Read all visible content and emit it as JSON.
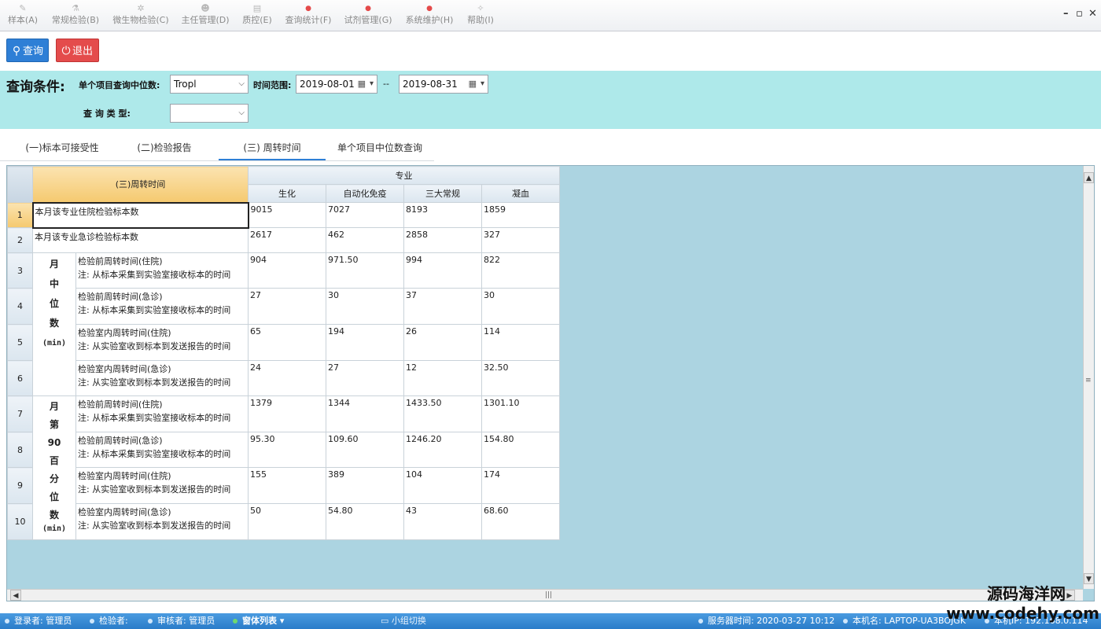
{
  "menu": [
    {
      "label": "样本(A)",
      "icon": "pen-icon"
    },
    {
      "label": "常规检验(B)",
      "icon": "flask-icon"
    },
    {
      "label": "微生物检验(C)",
      "icon": "microbe-icon"
    },
    {
      "label": "主任管理(D)",
      "icon": "people-icon"
    },
    {
      "label": "质控(E)",
      "icon": "doc-icon"
    },
    {
      "label": "查询统计(F)",
      "icon": "red-dot-icon"
    },
    {
      "label": "试剂管理(G)",
      "icon": "red-dot-icon"
    },
    {
      "label": "系统维护(H)",
      "icon": "red-dot-icon"
    },
    {
      "label": "帮助(I)",
      "icon": "help-icon"
    }
  ],
  "window_controls": {
    "minimize": "–",
    "restore": "▫",
    "close": "✕"
  },
  "toolbar": {
    "query_label": "查询",
    "exit_label": "退出",
    "query_icon": "search-icon",
    "exit_icon": "power-icon"
  },
  "conditions": {
    "title": "查询条件:",
    "median_label": "单个项目查询中位数:",
    "median_value": "Tropl",
    "time_label": "时间范围:",
    "date_from": "2019-08-01",
    "date_sep": "--",
    "date_to": "2019-08-31",
    "type_label": "查 询 类 型:",
    "type_value": ""
  },
  "tabs": [
    {
      "label": "(一)标本可接受性",
      "active": false
    },
    {
      "label": "(二)检验报告",
      "active": false
    },
    {
      "label": "(三) 周转时间",
      "active": true
    },
    {
      "label": "单个项目中位数查询",
      "active": false
    }
  ],
  "grid": {
    "main_header": "(三)周转时间",
    "group_header": "专业",
    "columns": [
      "生化",
      "自动化免疫",
      "三大常规",
      "凝血"
    ],
    "row_numbers": [
      "1",
      "2",
      "3",
      "4",
      "5",
      "6",
      "7",
      "8",
      "9",
      "10"
    ],
    "summary_rows": [
      {
        "label": "本月该专业住院检验标本数",
        "values": [
          "9015",
          "7027",
          "8193",
          "1859"
        ]
      },
      {
        "label": "本月该专业急诊检验标本数",
        "values": [
          "2617",
          "462",
          "2858",
          "327"
        ]
      }
    ],
    "groups": [
      {
        "chars": [
          "月",
          "中",
          "位",
          "数"
        ],
        "unit": "(min)",
        "rows": [
          {
            "line1": "检验前周转时间(住院)",
            "line2": "注: 从标本采集到实验室接收标本的时间",
            "values": [
              "904",
              "971.50",
              "994",
              "822"
            ]
          },
          {
            "line1": "检验前周转时间(急诊)",
            "line2": "注: 从标本采集到实验室接收标本的时间",
            "values": [
              "27",
              "30",
              "37",
              "30"
            ]
          },
          {
            "line1": "检验室内周转时间(住院)",
            "line2": " 注: 从实验室收到标本到发送报告的时间",
            "values": [
              "65",
              "194",
              "26",
              "114"
            ]
          },
          {
            "line1": "检验室内周转时间(急诊)",
            "line2": " 注: 从实验室收到标本到发送报告的时间",
            "values": [
              "24",
              "27",
              "12",
              "32.50"
            ]
          }
        ]
      },
      {
        "chars": [
          "月",
          "第",
          "90",
          "百",
          "分",
          "位",
          "数"
        ],
        "unit": "(min)",
        "rows": [
          {
            "line1": "检验前周转时间(住院)",
            "line2": "注: 从标本采集到实验室接收标本的时间",
            "values": [
              "1379",
              "1344",
              "1433.50",
              "1301.10"
            ]
          },
          {
            "line1": "检验前周转时间(急诊)",
            "line2": "注: 从标本采集到实验室接收标本的时间",
            "values": [
              "95.30",
              "109.60",
              "1246.20",
              "154.80"
            ]
          },
          {
            "line1": "检验室内周转时间(住院)",
            "line2": "注: 从实验室收到标本到发送报告的时间",
            "values": [
              "155",
              "389",
              "104",
              "174"
            ]
          },
          {
            "line1": "检验室内周转时间(急诊)",
            "line2": "注: 从实验室收到标本到发送报告的时间",
            "values": [
              "50",
              "54.80",
              "43",
              "68.60"
            ]
          }
        ]
      }
    ]
  },
  "status": {
    "registrar": "登录者: 管理员",
    "inspector": "检验者:",
    "reviewer": "审核者: 管理员",
    "window_list": "窗体列表",
    "group_switch": "小组切换",
    "server_time": "服务器时间: 2020-03-27 10:12",
    "machine": "本机名: LAPTOP-UA3BOJGK",
    "ip": "本机IP: 192.168.0.114"
  },
  "watermark": {
    "line1": "源码海洋网",
    "line2": "www.codehy.com"
  }
}
